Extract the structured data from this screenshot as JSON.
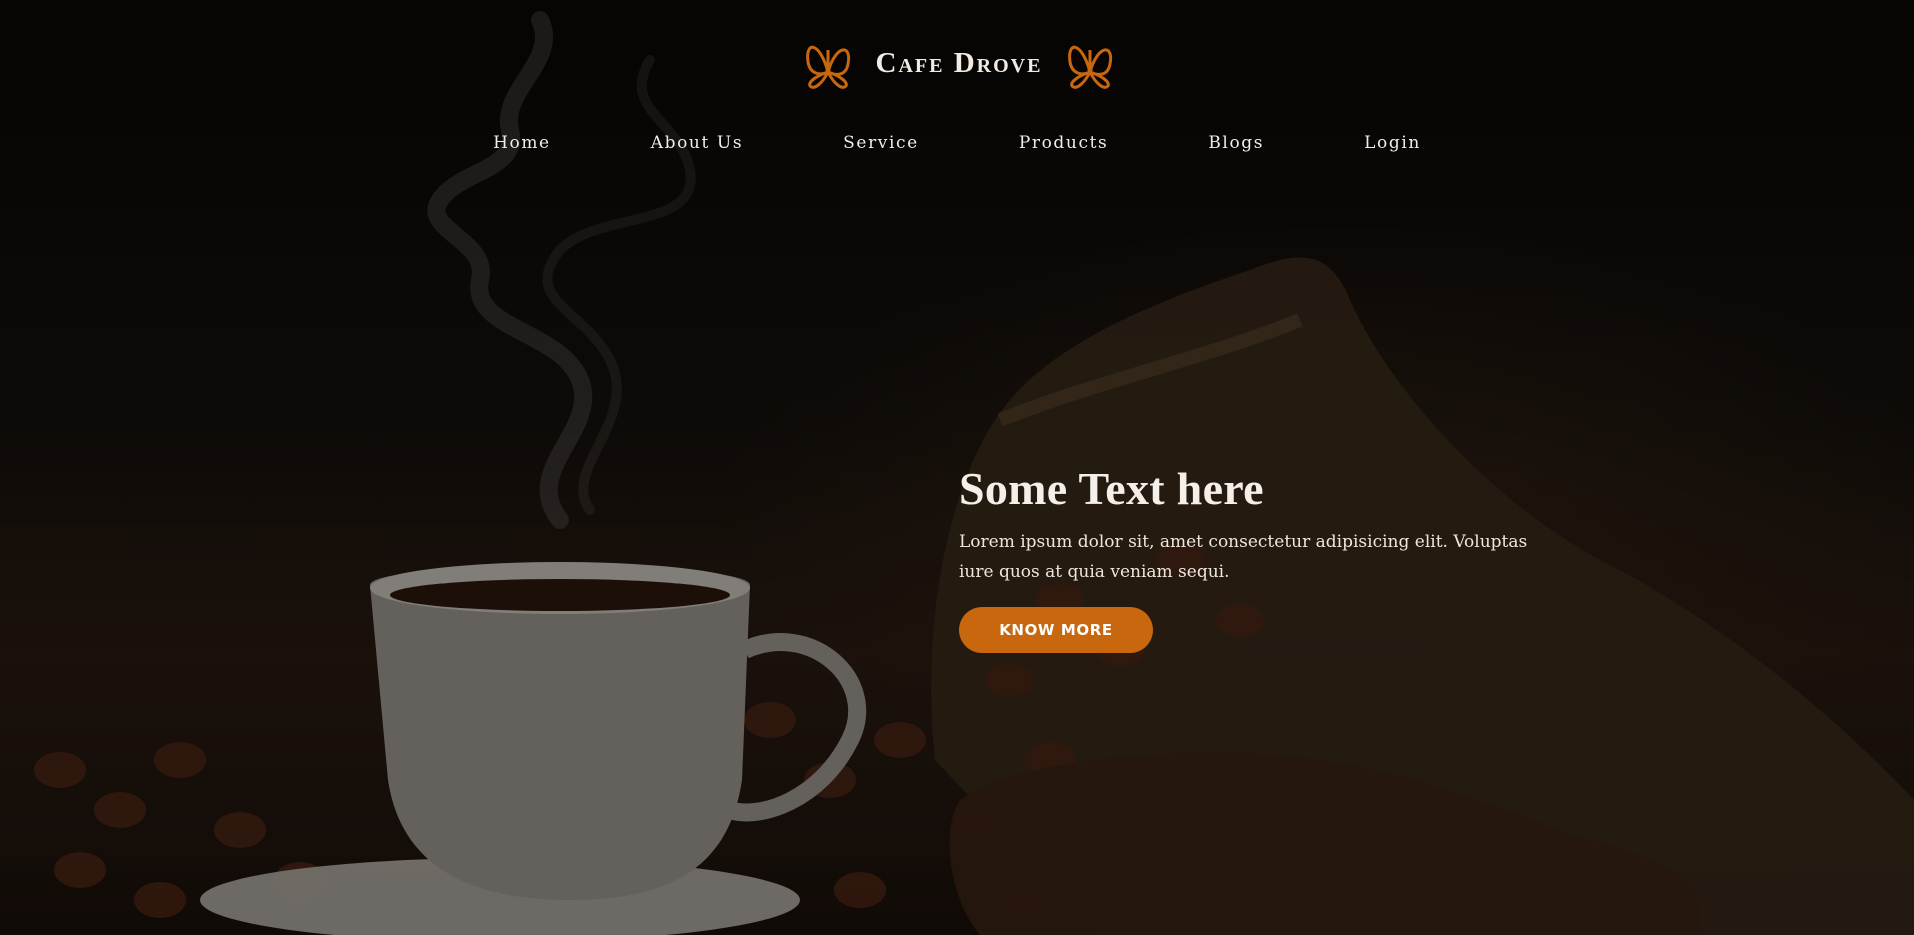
{
  "brand": {
    "name": "Cafe Drove",
    "accent_color": "#c8670e",
    "logo_icon": "butterfly-icon"
  },
  "nav": {
    "items": [
      {
        "label": "Home"
      },
      {
        "label": "About Us"
      },
      {
        "label": "Service"
      },
      {
        "label": "Products"
      },
      {
        "label": "Blogs"
      },
      {
        "label": "Login"
      }
    ]
  },
  "hero": {
    "headline": "Some Text here",
    "description": "Lorem ipsum dolor sit, amet consectetur adipisicing elit. Voluptas iure quos at quia veniam sequi.",
    "cta_label": "KNOW MORE",
    "background_image": "coffee cup with coffee beans and burlap sack"
  }
}
